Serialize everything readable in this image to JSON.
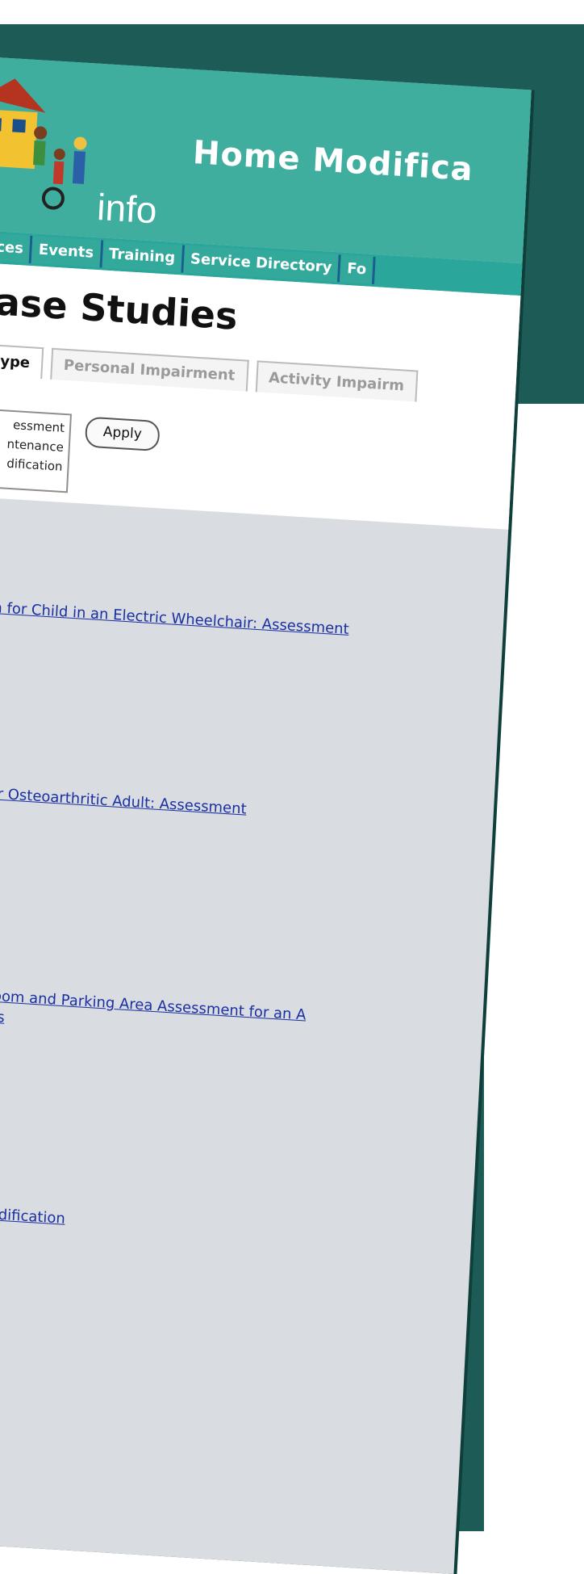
{
  "header": {
    "title": "Home Modifica",
    "subtitle": "info"
  },
  "nav": [
    {
      "label": "urces"
    },
    {
      "label": "Events"
    },
    {
      "label": "Training"
    },
    {
      "label": "Service Directory"
    },
    {
      "label": "Fo"
    }
  ],
  "page": {
    "title": "ase Studies"
  },
  "tabs": [
    {
      "label": "ype"
    },
    {
      "label": "Personal Impairment"
    },
    {
      "label": "Activity Impairm"
    }
  ],
  "filter": {
    "options": [
      "essment",
      "ntenance",
      "dification"
    ],
    "apply_label": "Apply"
  },
  "case_links": [
    {
      "line1": "om for Child in an Electric Wheelchair: Assessment",
      "line2": ""
    },
    {
      "line1": "n for Osteoarthritic Adult: Assessment",
      "line2": ""
    },
    {
      "line1": "Bedroom and Parking Area Assessment for an A",
      "line2": "lerosis"
    },
    {
      "line1": "om modification",
      "line2": ""
    }
  ],
  "colors": {
    "frame": "#1d5c56",
    "header": "#3fae9e",
    "link": "#1a2fa0",
    "content_bg": "#d9dde2"
  }
}
